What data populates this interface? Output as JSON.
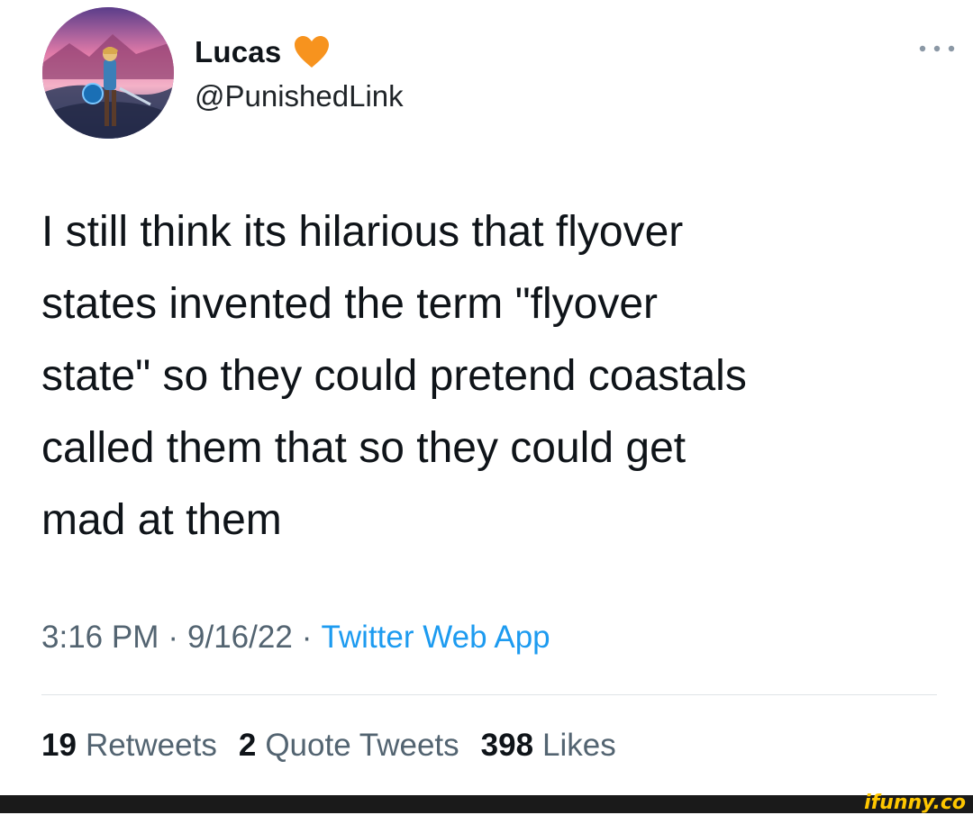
{
  "tweet": {
    "author": {
      "display_name": "Lucas",
      "handle": "@PunishedLink",
      "badge_icon": "orange-heart-icon"
    },
    "text": "I still think its hilarious that flyover\nstates invented the term \"flyover\nstate\" so they could pretend coastals\ncalled them that so they could get\nmad at them",
    "time": "3:16 PM",
    "date": "9/16/22",
    "separator": "·",
    "source": "Twitter Web App",
    "stats": {
      "retweets": {
        "count": "19",
        "label": "Retweets"
      },
      "quote_tweets": {
        "count": "2",
        "label": "Quote Tweets"
      },
      "likes": {
        "count": "398",
        "label": "Likes"
      }
    },
    "more_icon": "more-horizontal-icon"
  },
  "watermark": {
    "text": "ifunny.co"
  },
  "colors": {
    "text_primary": "#0f1419",
    "text_secondary": "#536471",
    "link": "#1d9bf0",
    "heart": "#f7931e",
    "footer_bg": "#1a1a1a",
    "watermark": "#ffc700"
  }
}
